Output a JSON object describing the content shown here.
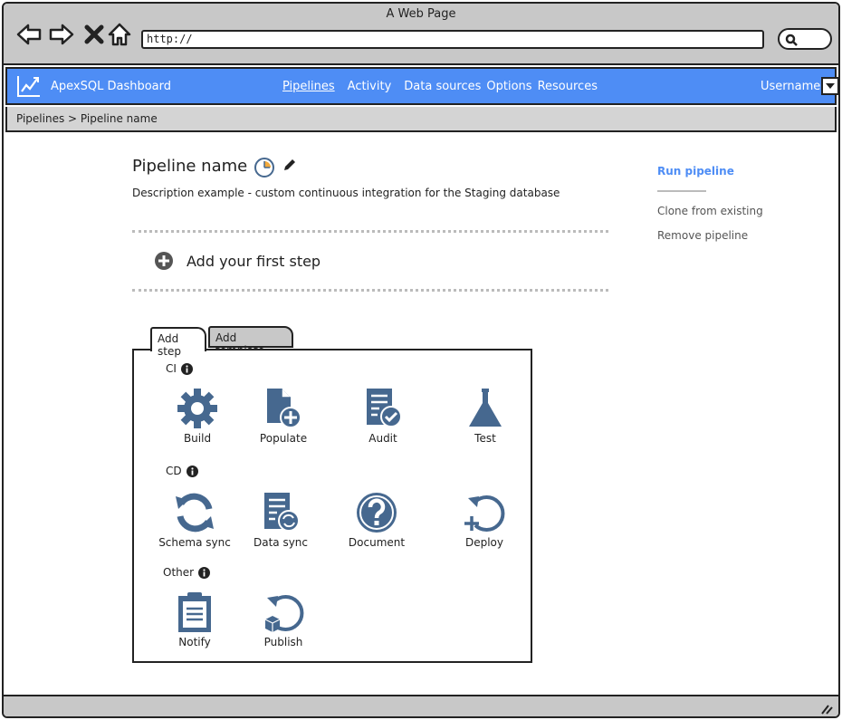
{
  "browser": {
    "title": "A Web Page",
    "url": "http://"
  },
  "appbar": {
    "app_title": "ApexSQL Dashboard",
    "nav": [
      "Pipelines",
      "Activity",
      "Data sources",
      "Options",
      "Resources"
    ],
    "active_nav": "Pipelines",
    "username": "Username"
  },
  "breadcrumb": "Pipelines > Pipeline name",
  "pipeline": {
    "name": "Pipeline name",
    "description": "Description example - custom continuous integration for the Staging database",
    "add_first_step": "Add your first step"
  },
  "side_actions": {
    "run": "Run pipeline",
    "clone": "Clone from existing",
    "remove": "Remove pipeline"
  },
  "tabs": {
    "active": "Add step",
    "inactive": "Add template"
  },
  "groups": {
    "ci": {
      "label": "CI",
      "tools": [
        "Build",
        "Populate",
        "Audit",
        "Test"
      ]
    },
    "cd": {
      "label": "CD",
      "tools": [
        "Schema sync",
        "Data sync",
        "Document",
        "Deploy"
      ]
    },
    "other": {
      "label": "Other",
      "tools": [
        "Notify",
        "Publish"
      ]
    }
  },
  "colors": {
    "accent": "#4e8df5",
    "icon": "#46688f",
    "chrome": "#c8c8c8"
  }
}
